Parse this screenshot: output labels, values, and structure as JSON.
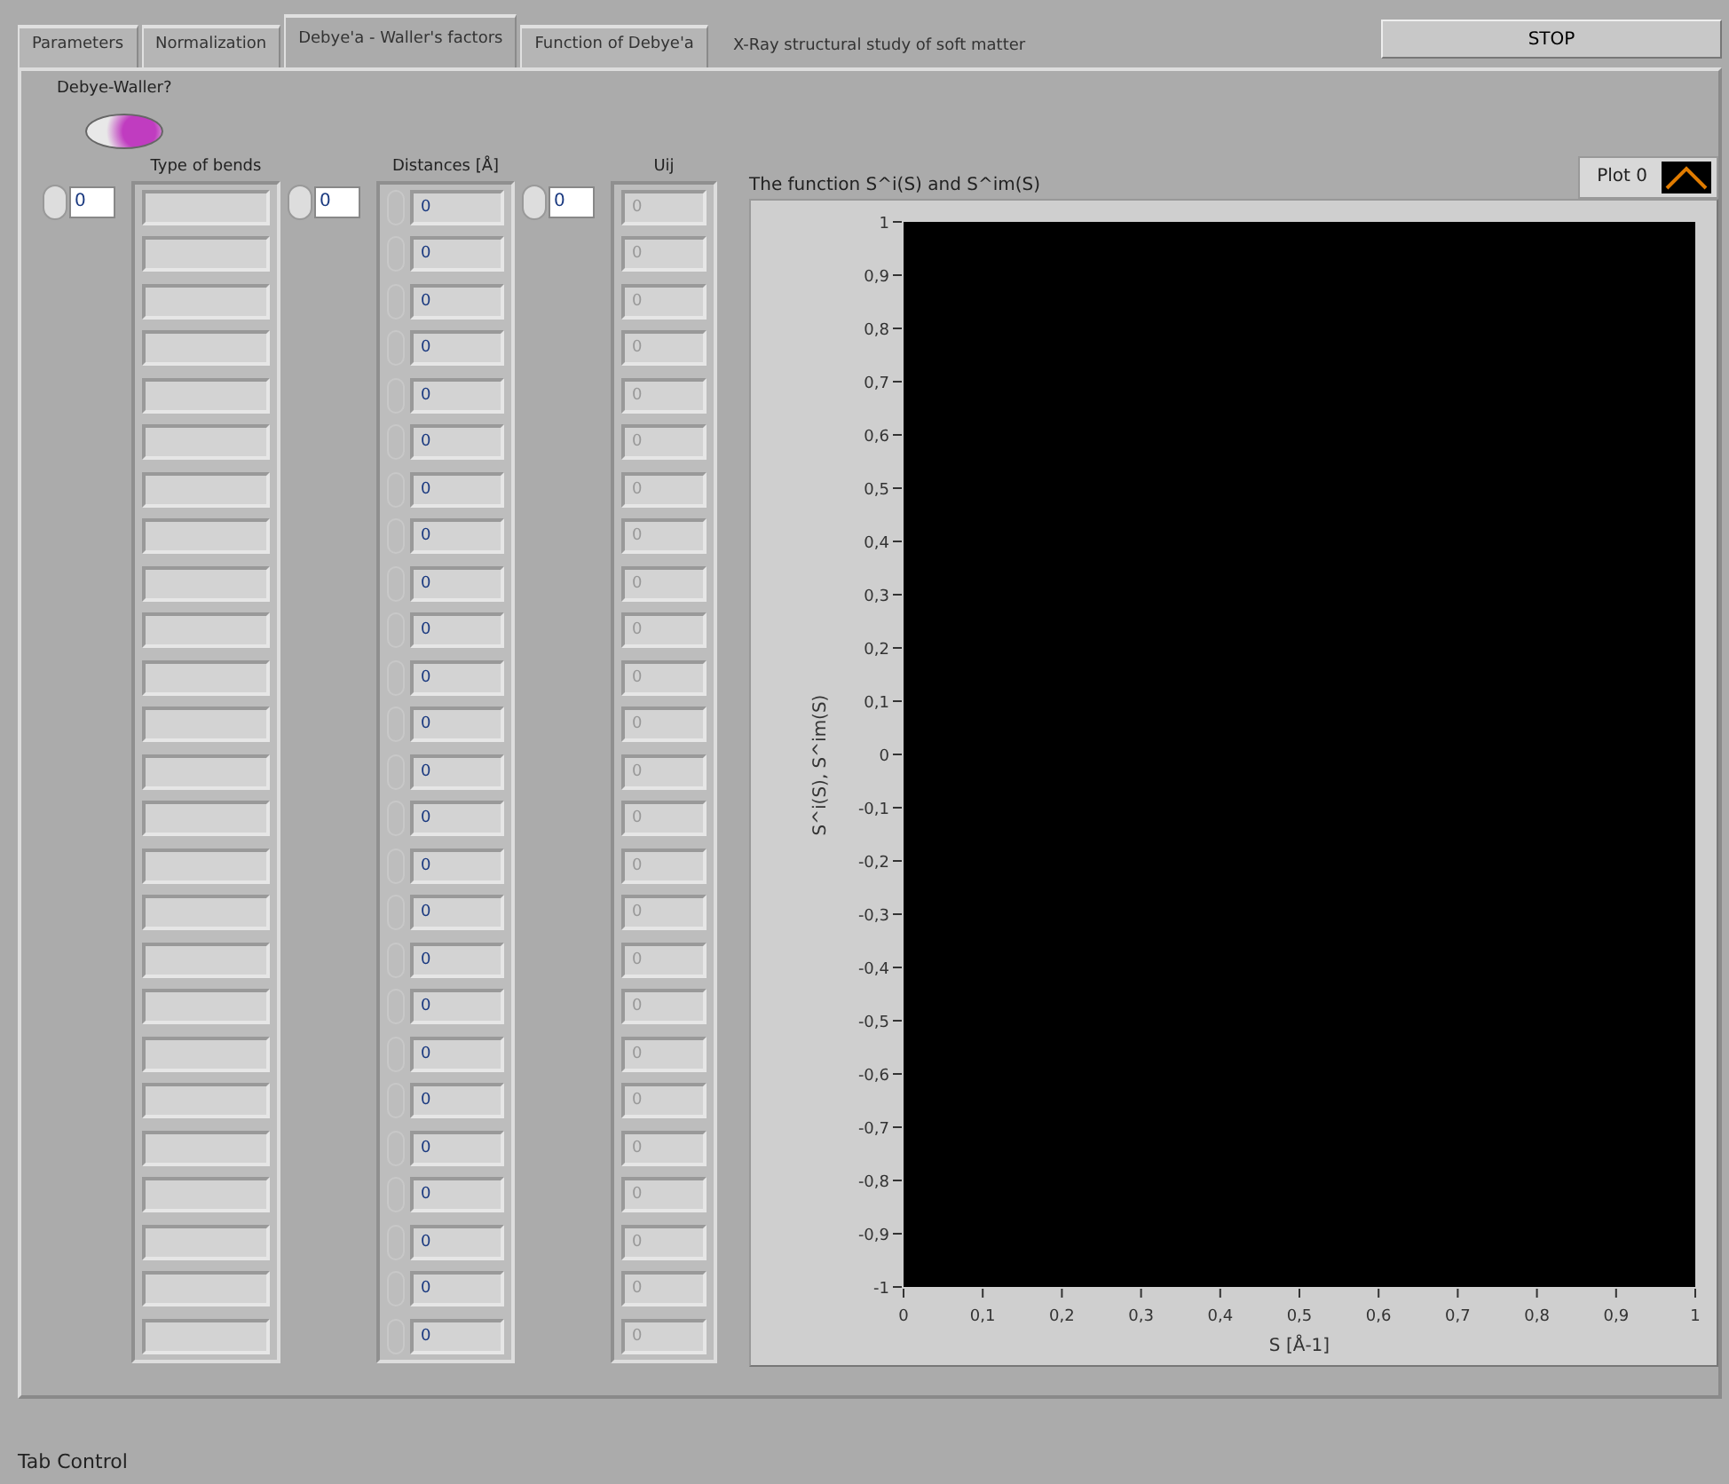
{
  "tabs": [
    {
      "label": "Parameters",
      "selected": false
    },
    {
      "label": "Normalization",
      "selected": false
    },
    {
      "label": "Debye'a - Waller's factors",
      "selected": true
    },
    {
      "label": "Function of Debye'a",
      "selected": false
    }
  ],
  "app_title": "X-Ray structural study of soft matter",
  "stop_button": {
    "label": "STOP"
  },
  "debye_waller_switch": {
    "label": "Debye-Waller?",
    "on": true
  },
  "type_of_bonds": {
    "label": "Type of bends",
    "index": "0",
    "elements": [
      {
        "kind": "empty"
      },
      {
        "kind": "empty"
      },
      {
        "kind": "empty"
      },
      {
        "kind": "empty"
      },
      {
        "kind": "empty"
      },
      {
        "kind": "empty"
      },
      {
        "kind": "empty"
      },
      {
        "kind": "empty"
      },
      {
        "kind": "empty"
      },
      {
        "kind": "empty"
      },
      {
        "kind": "empty"
      },
      {
        "kind": "empty"
      },
      {
        "kind": "empty"
      },
      {
        "kind": "empty"
      },
      {
        "kind": "empty"
      },
      {
        "kind": "empty"
      },
      {
        "kind": "empty"
      },
      {
        "kind": "empty"
      },
      {
        "kind": "empty"
      },
      {
        "kind": "empty"
      },
      {
        "kind": "empty"
      },
      {
        "kind": "empty"
      },
      {
        "kind": "empty"
      },
      {
        "kind": "empty"
      },
      {
        "kind": "empty"
      }
    ]
  },
  "distances": {
    "label": "Distances [Å]",
    "index": "0",
    "disabled": true,
    "values": [
      "0",
      "0",
      "0",
      "0",
      "0",
      "0",
      "0",
      "0",
      "0",
      "0",
      "0",
      "0",
      "0",
      "0",
      "0",
      "0",
      "0",
      "0",
      "0",
      "0",
      "0",
      "0",
      "0",
      "0",
      "0"
    ]
  },
  "uij": {
    "label": "Uij",
    "index": "0",
    "disabled": true,
    "values": [
      "0",
      "0",
      "0",
      "0",
      "0",
      "0",
      "0",
      "0",
      "0",
      "0",
      "0",
      "0",
      "0",
      "0",
      "0",
      "0",
      "0",
      "0",
      "0",
      "0",
      "0",
      "0",
      "0",
      "0",
      "0"
    ]
  },
  "graph": {
    "legend": {
      "name": "Plot 0",
      "color": "#e07b00"
    },
    "chart_data": {
      "type": "line",
      "title": "The function S^i(S) and S^im(S)",
      "xlabel": "S [Å-1]",
      "ylabel": "S^i(S), S^im(S)",
      "xlim": [
        0,
        1
      ],
      "ylim": [
        -1,
        1
      ],
      "xticks": [
        {
          "value": 0,
          "label": "0"
        },
        {
          "value": 0.1,
          "label": "0,1"
        },
        {
          "value": 0.2,
          "label": "0,2"
        },
        {
          "value": 0.3,
          "label": "0,3"
        },
        {
          "value": 0.4,
          "label": "0,4"
        },
        {
          "value": 0.5,
          "label": "0,5"
        },
        {
          "value": 0.6,
          "label": "0,6"
        },
        {
          "value": 0.7,
          "label": "0,7"
        },
        {
          "value": 0.8,
          "label": "0,8"
        },
        {
          "value": 0.9,
          "label": "0,9"
        },
        {
          "value": 1,
          "label": "1"
        }
      ],
      "yticks": [
        {
          "value": 1,
          "label": "1"
        },
        {
          "value": 0.9,
          "label": "0,9"
        },
        {
          "value": 0.8,
          "label": "0,8"
        },
        {
          "value": 0.7,
          "label": "0,7"
        },
        {
          "value": 0.6,
          "label": "0,6"
        },
        {
          "value": 0.5,
          "label": "0,5"
        },
        {
          "value": 0.4,
          "label": "0,4"
        },
        {
          "value": 0.3,
          "label": "0,3"
        },
        {
          "value": 0.2,
          "label": "0,2"
        },
        {
          "value": 0.1,
          "label": "0,1"
        },
        {
          "value": 0,
          "label": "0"
        },
        {
          "value": -0.1,
          "label": "-0,1"
        },
        {
          "value": -0.2,
          "label": "-0,2"
        },
        {
          "value": -0.3,
          "label": "-0,3"
        },
        {
          "value": -0.4,
          "label": "-0,4"
        },
        {
          "value": -0.5,
          "label": "-0,5"
        },
        {
          "value": -0.6,
          "label": "-0,6"
        },
        {
          "value": -0.7,
          "label": "-0,7"
        },
        {
          "value": -0.8,
          "label": "-0,8"
        },
        {
          "value": -0.9,
          "label": "-0,9"
        },
        {
          "value": -1,
          "label": "-1"
        }
      ]
    }
  },
  "status_label": "Tab Control"
}
